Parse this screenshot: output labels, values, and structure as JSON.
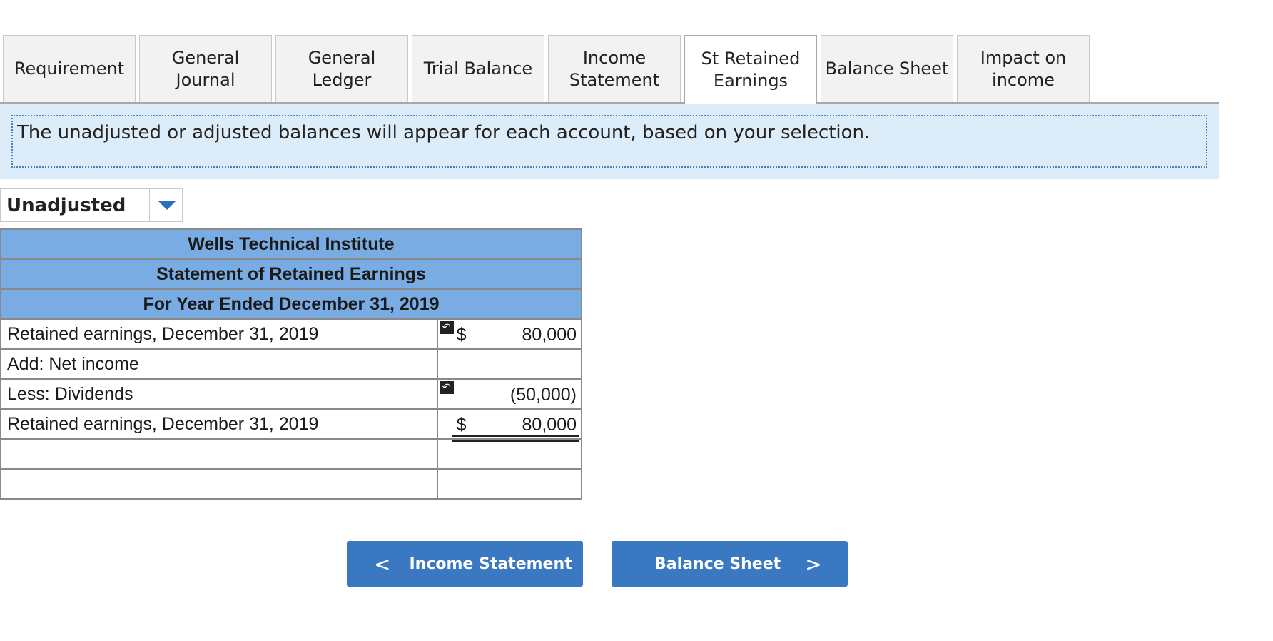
{
  "tabs": [
    {
      "label": "Requirement",
      "active": false
    },
    {
      "label": "General\nJournal",
      "active": false
    },
    {
      "label": "General\nLedger",
      "active": false
    },
    {
      "label": "Trial Balance",
      "active": false
    },
    {
      "label": "Income\nStatement",
      "active": false
    },
    {
      "label": "St Retained\nEarnings",
      "active": true
    },
    {
      "label": "Balance Sheet",
      "active": false
    },
    {
      "label": "Impact on\nincome",
      "active": false
    }
  ],
  "info_text": "The unadjusted or adjusted balances will appear for each account, based on your selection.",
  "balance_select": {
    "value": "Unadjusted"
  },
  "statement": {
    "company": "Wells Technical Institute",
    "title": "Statement of Retained Earnings",
    "period": "For Year Ended December 31, 2019",
    "rows": [
      {
        "label": "Retained earnings, December 31, 2019",
        "dollar": "$",
        "amount": "80,000",
        "flag": true
      },
      {
        "label": "Add:  Net income",
        "dollar": "",
        "amount": "",
        "flag": false
      },
      {
        "label": "Less:  Dividends",
        "dollar": "",
        "amount": "(50,000)",
        "flag": true
      },
      {
        "label": "Retained earnings, December 31, 2019",
        "dollar": "$",
        "amount": "80,000",
        "flag": false
      },
      {
        "label": "",
        "dollar": "",
        "amount": "",
        "flag": false
      },
      {
        "label": "",
        "dollar": "",
        "amount": "",
        "flag": false
      }
    ]
  },
  "nav": {
    "prev_label": "Income Statement",
    "next_label": "Balance Sheet",
    "prev_chevron": "<",
    "next_chevron": ">"
  },
  "colors": {
    "header_blue": "#7aace4",
    "button_blue": "#3a78c2",
    "info_bg": "#dcecf9"
  }
}
